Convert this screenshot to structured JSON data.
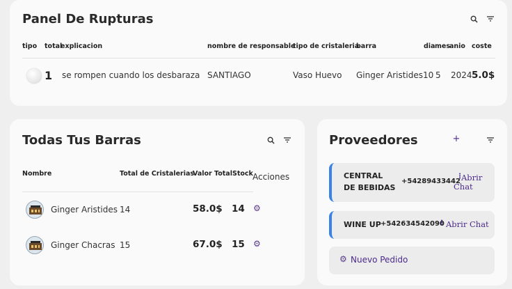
{
  "rupturas": {
    "title": "Panel De Rupturas",
    "headers": {
      "tipo": "tipo",
      "total": "total",
      "explicacion": "explicacion",
      "responsable": "nombre de responsable",
      "cristaleria": "tipo de cristaleria",
      "barra": "barra",
      "dia": "dia",
      "mes": "mes",
      "anio": "anio",
      "coste": "coste"
    },
    "row": {
      "total": "1",
      "explicacion": "se rompen cuando los desbaraza",
      "responsable": "SANTIAGO",
      "cristaleria": "Vaso Huevo",
      "barra": "Ginger Aristides",
      "dia": "10",
      "mes": "5",
      "anio": "2024",
      "coste": "5.0$"
    }
  },
  "barras": {
    "title": "Todas Tus Barras",
    "headers": {
      "nombre": "Nombre",
      "total": "Total de Cristalerias",
      "valor": "Valor Total",
      "stock": "Stock",
      "acciones": "Acciones"
    },
    "rows": [
      {
        "nombre": "Ginger Aristides",
        "total": "14",
        "valor": "58.0$",
        "stock": "14"
      },
      {
        "nombre": "Ginger Chacras",
        "total": "15",
        "valor": "67.0$",
        "stock": "15"
      }
    ]
  },
  "proveedores": {
    "title": "Proveedores",
    "add_label": "+",
    "items": [
      {
        "name": "CENTRAL DE BEBIDAS",
        "phone": "+54289433442",
        "menu": "⋮",
        "action": "Abrir Chat"
      },
      {
        "name": "WINE UP",
        "phone": "+542634542090",
        "menu": "⋮",
        "action": "Abrir  Chat"
      }
    ],
    "nuevo_label": "Nuevo Pedido"
  },
  "colors": {
    "accent": "#4a2a8a",
    "provider_border": "#3a82e6",
    "card_bg": "#fafafa",
    "page_bg": "#efefef"
  }
}
